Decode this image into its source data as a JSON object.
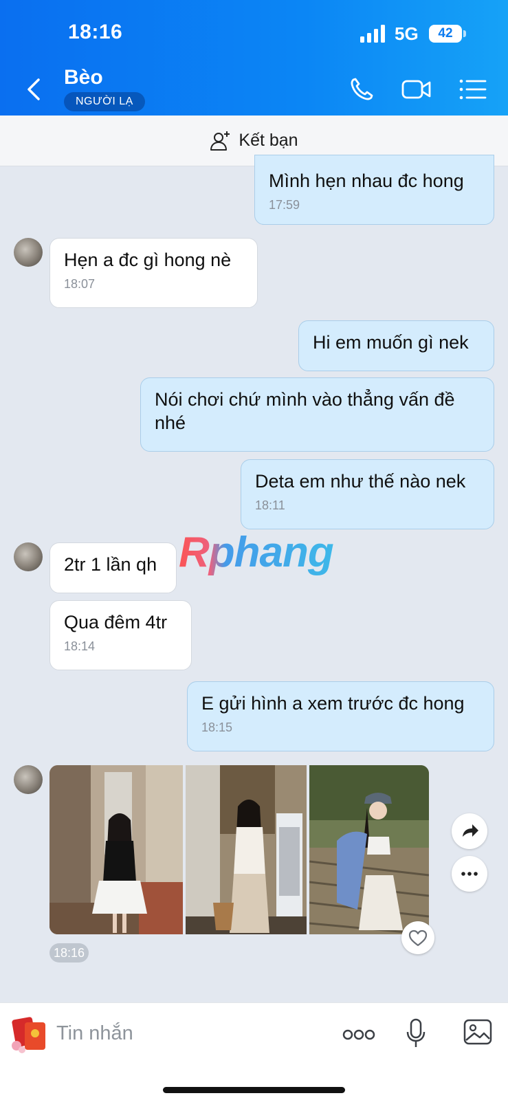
{
  "status_bar": {
    "time": "18:16",
    "network": "5G",
    "battery": "42"
  },
  "header": {
    "contact_name": "Bèo",
    "badge": "NGƯỜI LẠ"
  },
  "add_friend": {
    "label": "Kết bạn"
  },
  "messages": [
    {
      "side": "out",
      "text": "Mình hẹn nhau đc hong",
      "time": "17:59"
    },
    {
      "side": "in",
      "text": "Hẹn a đc gì hong nè",
      "time": "18:07"
    },
    {
      "side": "out",
      "text": "Hi em muốn gì nek",
      "time": ""
    },
    {
      "side": "out",
      "text": "Nói chơi chứ mình vào thẳng vấn đề nhé",
      "time": ""
    },
    {
      "side": "out",
      "text": "Deta em như thế nào nek",
      "time": "18:11"
    },
    {
      "side": "in",
      "text": "2tr 1 lần qh",
      "time": ""
    },
    {
      "side": "in",
      "text": "Qua đêm 4tr",
      "time": "18:14"
    },
    {
      "side": "out",
      "text": "E gửi hình a xem trước đc hong",
      "time": "18:15"
    }
  ],
  "photo_message": {
    "time": "18:16",
    "photo_count": 3
  },
  "watermark": "Rphang",
  "composer": {
    "placeholder": "Tin nhắn"
  },
  "colors": {
    "header_blue": "#0b86f5",
    "outgoing_bubble": "#d4ecfd",
    "incoming_bubble": "#ffffff",
    "chat_bg": "#e3e8f0"
  }
}
